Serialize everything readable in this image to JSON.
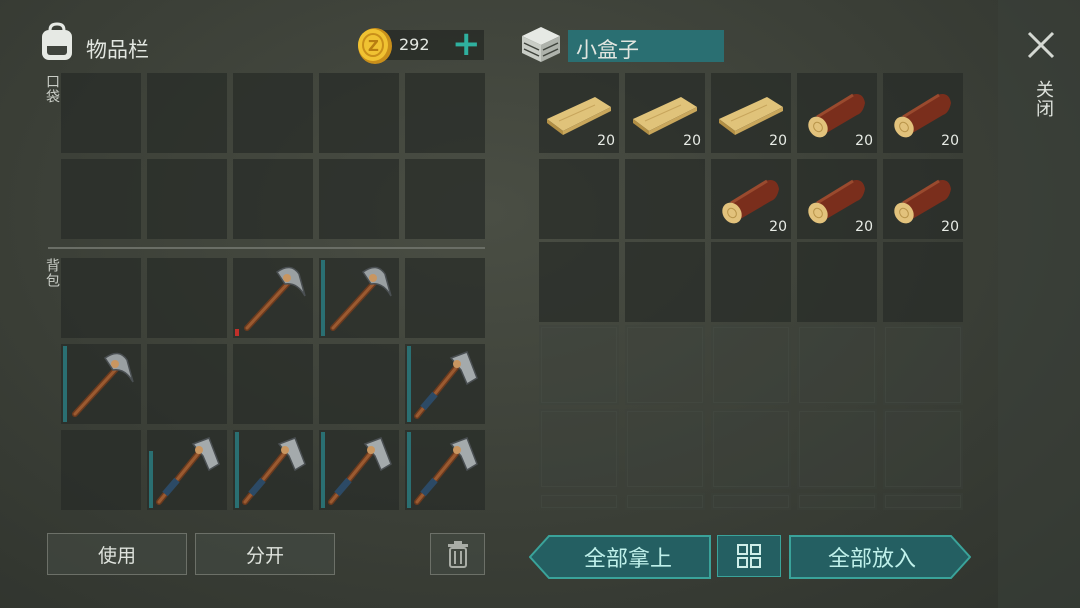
{
  "inventory": {
    "title": "物品栏",
    "coins": "292",
    "pocket_label": "口袋",
    "backpack_label": "背包"
  },
  "box": {
    "title": "小盒子"
  },
  "close_label": "关闭",
  "buttons": {
    "use": "使用",
    "split": "分开",
    "take_all": "全部拿上",
    "put_all": "全部放入"
  },
  "box_items": [
    {
      "item": "plank",
      "count": "20"
    },
    {
      "item": "plank",
      "count": "20"
    },
    {
      "item": "plank",
      "count": "20"
    },
    {
      "item": "log",
      "count": "20"
    },
    {
      "item": "log",
      "count": "20"
    },
    {
      "item": "empty",
      "count": ""
    },
    {
      "item": "empty",
      "count": ""
    },
    {
      "item": "log",
      "count": "20"
    },
    {
      "item": "log",
      "count": "20"
    },
    {
      "item": "log",
      "count": "20"
    }
  ],
  "backpack_items": [
    {
      "item": "empty",
      "durability": null
    },
    {
      "item": "empty",
      "durability": null
    },
    {
      "item": "stone-pickaxe",
      "durability": 0.08
    },
    {
      "item": "stone-pickaxe",
      "durability": 1.0
    },
    {
      "item": "empty",
      "durability": null
    },
    {
      "item": "stone-pickaxe",
      "durability": 1.0
    },
    {
      "item": "empty",
      "durability": null
    },
    {
      "item": "empty",
      "durability": null
    },
    {
      "item": "empty",
      "durability": null
    },
    {
      "item": "stone-axe",
      "durability": 1.0
    },
    {
      "item": "empty",
      "durability": null
    },
    {
      "item": "stone-axe",
      "durability": 0.75
    },
    {
      "item": "stone-axe",
      "durability": 1.0
    },
    {
      "item": "stone-axe",
      "durability": 1.0
    },
    {
      "item": "stone-axe",
      "durability": 1.0
    }
  ],
  "icons": [
    "backpack-icon",
    "coin-icon",
    "add-coins-icon",
    "box-icon",
    "close-icon",
    "trash-icon",
    "sort-icon"
  ],
  "colors": {
    "teal": "#2a6f72",
    "accent": "#2aa59a",
    "durability_low": "#c0302a"
  }
}
